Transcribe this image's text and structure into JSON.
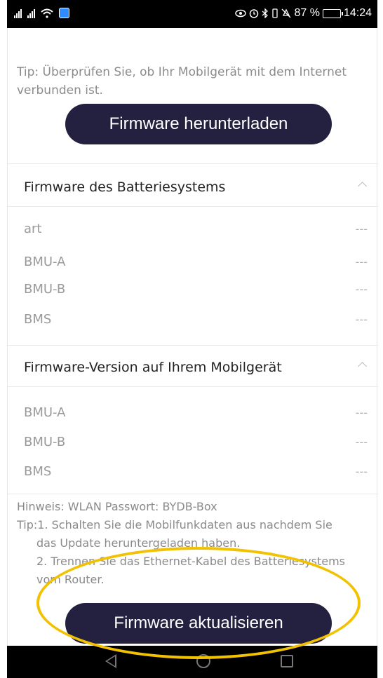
{
  "status_bar": {
    "battery_percent": "87 %",
    "time": "14:24",
    "battery_level": 0.87
  },
  "page": {
    "tip_internet": "Tip: Überprüfen Sie, ob Ihr Mobilgerät mit dem Internet verbunden ist.",
    "download_button": "Firmware herunterladen",
    "battery_section": {
      "title": "Firmware des Batteriesystems",
      "rows": [
        {
          "label": "art",
          "value": "---"
        },
        {
          "label": "BMU-A",
          "value": "---"
        },
        {
          "label": "BMU-B",
          "value": "---"
        },
        {
          "label": "BMS",
          "value": "---"
        }
      ]
    },
    "device_section": {
      "title": "Firmware-Version auf Ihrem Mobilgerät",
      "rows": [
        {
          "label": "BMU-A",
          "value": "---"
        },
        {
          "label": "BMU-B",
          "value": "---"
        },
        {
          "label": "BMS",
          "value": "---"
        }
      ]
    },
    "notes": {
      "wlan": "Hinweis: WLAN Passwort: BYDB-Box",
      "tip1": "Tip:1. Schalten Sie die Mobilfunkdaten aus nachdem Sie",
      "tip1_cont": "das Update heruntergeladen haben.",
      "tip2": "2. Trennen Sie das Ethernet-Kabel des Batteriesystems",
      "tip2_cont": "vom Router."
    },
    "update_button": "Firmware aktualisieren"
  },
  "colors": {
    "button_bg": "#24203f",
    "highlight": "#f2c200"
  }
}
